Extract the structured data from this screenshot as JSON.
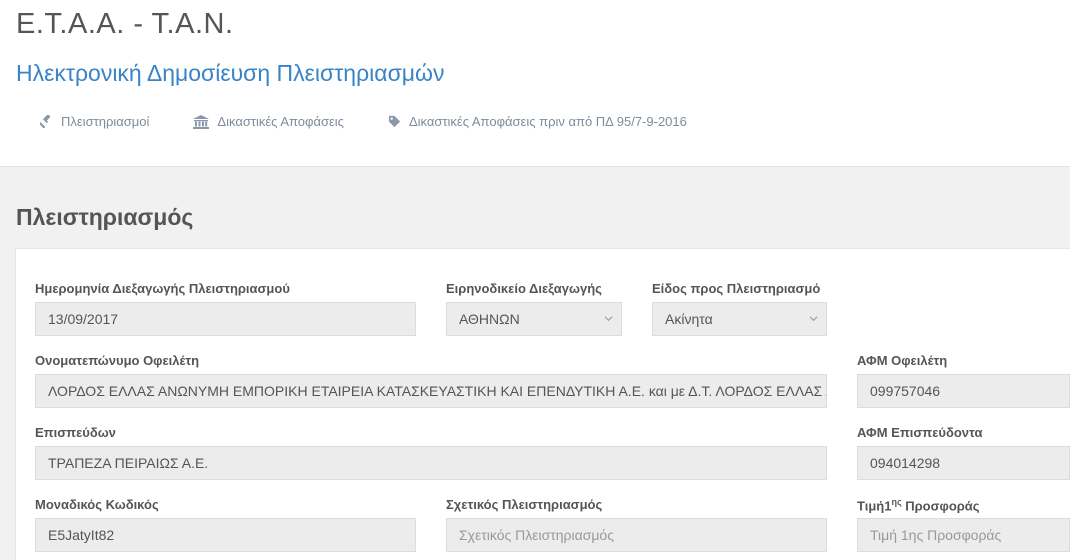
{
  "header": {
    "org_title": "Ε.Τ.Α.Α. - Τ.Α.Ν.",
    "subtitle": "Ηλεκτρονική Δημοσίευση Πλειστηριασμών",
    "nav": [
      {
        "label": "Πλειστηριασμοί",
        "icon": "gavel-icon"
      },
      {
        "label": "Δικαστικές Αποφάσεις",
        "icon": "bank-icon"
      },
      {
        "label": "Δικαστικές Αποφάσεις πριν από ΠΔ 95/7-9-2016",
        "icon": "tag-icon"
      }
    ]
  },
  "section": {
    "title": "Πλειστηριασμός"
  },
  "form": {
    "auction_date": {
      "label": "Ημερομηνία Διεξαγωγής Πλειστηριασμού",
      "value": "13/09/2017"
    },
    "court": {
      "label": "Ειρηνοδικείο Διεξαγωγής",
      "value": "ΑΘΗΝΩΝ"
    },
    "item_type": {
      "label": "Είδος προς Πλειστηριασμό",
      "value": "Ακίνητα"
    },
    "debtor_name": {
      "label": "Ονοματεπώνυμο Οφειλέτη",
      "value": "ΛΟΡΔΟΣ ΕΛΛΑΣ ΑΝΩΝΥΜΗ ΕΜΠΟΡΙΚΗ ΕΤΑΙΡΕΙΑ ΚΑΤΑΣΚΕΥΑΣΤΙΚΗ ΚΑΙ ΕΠΕΝΔΥΤΙΚΗ Α.Ε. και με Δ.Τ. ΛΟΡΔΟΣ  ΕΛΛΑΣ Α.Ε."
    },
    "debtor_vat": {
      "label": "ΑΦΜ Οφειλέτη",
      "value": "099757046"
    },
    "pursuer": {
      "label": "Επισπεύδων",
      "value": "ΤΡΑΠΕΖΑ ΠΕΙΡΑΙΩΣ Α.Ε."
    },
    "pursuer_vat": {
      "label": "ΑΦΜ Επισπεύδοντα",
      "value": "094014298"
    },
    "unique_code": {
      "label": "Μοναδικός Κωδικός",
      "value": "E5JatyIt82"
    },
    "related_auction": {
      "label": "Σχετικός Πλειστηριασμός",
      "placeholder": "Σχετικός Πλειστηριασμός"
    },
    "first_bid_price": {
      "label_main": "Τιμή1",
      "label_sup": "ης",
      "label_tail": " Προσφοράς",
      "placeholder": "Τιμή 1ης Προσφοράς"
    }
  }
}
